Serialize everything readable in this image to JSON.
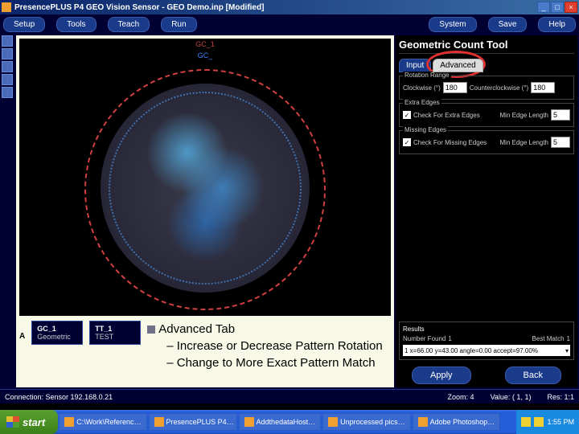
{
  "window": {
    "title": "PresencePLUS P4 GEO Vision Sensor - GEO Demo.inp [Modified]",
    "min": "_",
    "max": "□",
    "close": "×"
  },
  "menu": {
    "setup": "Setup",
    "tools": "Tools",
    "teach": "Teach",
    "run": "Run",
    "system": "System",
    "save": "Save",
    "help": "Help"
  },
  "canvas": {
    "label1": "GC_1",
    "label2": "GC_"
  },
  "toolboxes": {
    "a_label": "A",
    "gc1_name": "GC_1",
    "gc1_type": "Geometric",
    "tt1_name": "TT_1",
    "tt1_type": "TEST"
  },
  "notes": {
    "title": "Advanced Tab",
    "line1": "– Increase or Decrease Pattern Rotation",
    "line2": "– Change to More Exact Pattern Match"
  },
  "panel": {
    "title": "Geometric Count Tool",
    "tab_input": "Input",
    "tab_advanced": "Advanced",
    "rot_title": "Rotation Range",
    "rot_cw_label": "Clockwise (°)",
    "rot_cw_val": "180",
    "rot_ccw_label": "Counterclockwise (°)",
    "rot_ccw_val": "180",
    "extra_title": "Extra Edges",
    "extra_chk": "✓",
    "extra_label": "Check For Extra Edges",
    "extra_min_label": "Min Edge Length",
    "extra_min_val": "5",
    "missing_title": "Missing Edges",
    "missing_chk": "✓",
    "missing_label": "Check For Missing Edges",
    "missing_min_label": "Min Edge Length",
    "missing_min_val": "5",
    "results_title": "Results",
    "num_found_label": "Number Found",
    "num_found_val": "1",
    "best_label": "Best Match",
    "best_val": "1",
    "result_line": "1 x=66.00 y=43.00 angle=0.00 accept=97.00%",
    "apply": "Apply",
    "back": "Back"
  },
  "status": {
    "conn": "Connection: Sensor 192.168.0.21",
    "zoom_l": "Zoom:",
    "zoom_v": "4",
    "val_l": "Value:",
    "val_v": "( 1, 1)",
    "res_l": "Res:",
    "res_v": "1:1"
  },
  "taskbar": {
    "start": "start",
    "t1": "C:\\Work\\Referenc…",
    "t2": "PresencePLUS P4…",
    "t3": "AddthedataHost…",
    "t4": "Unprocessed pics…",
    "t5": "Adobe Photoshop…",
    "clock": "1:55 PM"
  }
}
